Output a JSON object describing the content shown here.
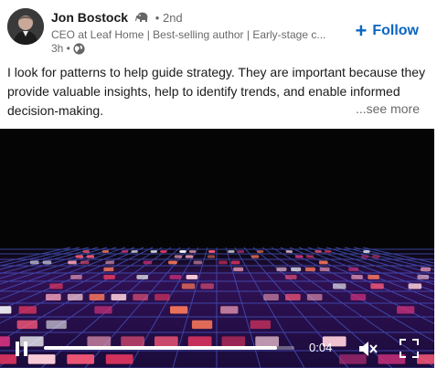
{
  "post": {
    "author": {
      "name": "Jon Bostock",
      "degree": "• 2nd",
      "headline": "CEO at Leaf Home | Best-selling author | Early-stage c...",
      "time": "3h •"
    },
    "follow_label": "Follow",
    "text": "I look for patterns to help guide strategy. They are important because they provide valuable insights, help to identify trends, and enable informed decision-making.",
    "see_more_label": "...see more"
  },
  "video": {
    "current_time": "0:04",
    "progress": 0.93
  },
  "icons": {
    "author_badge": "elephant-icon",
    "visibility": "globe-icon",
    "play_state": "pause-icon",
    "volume": "mute-icon",
    "fullscreen": "fullscreen-icon"
  },
  "colors": {
    "accent": "#0a66c2",
    "video_bg": "#000000",
    "grid_pink": "#e0355f",
    "grid_blue": "#3a4bd8"
  }
}
